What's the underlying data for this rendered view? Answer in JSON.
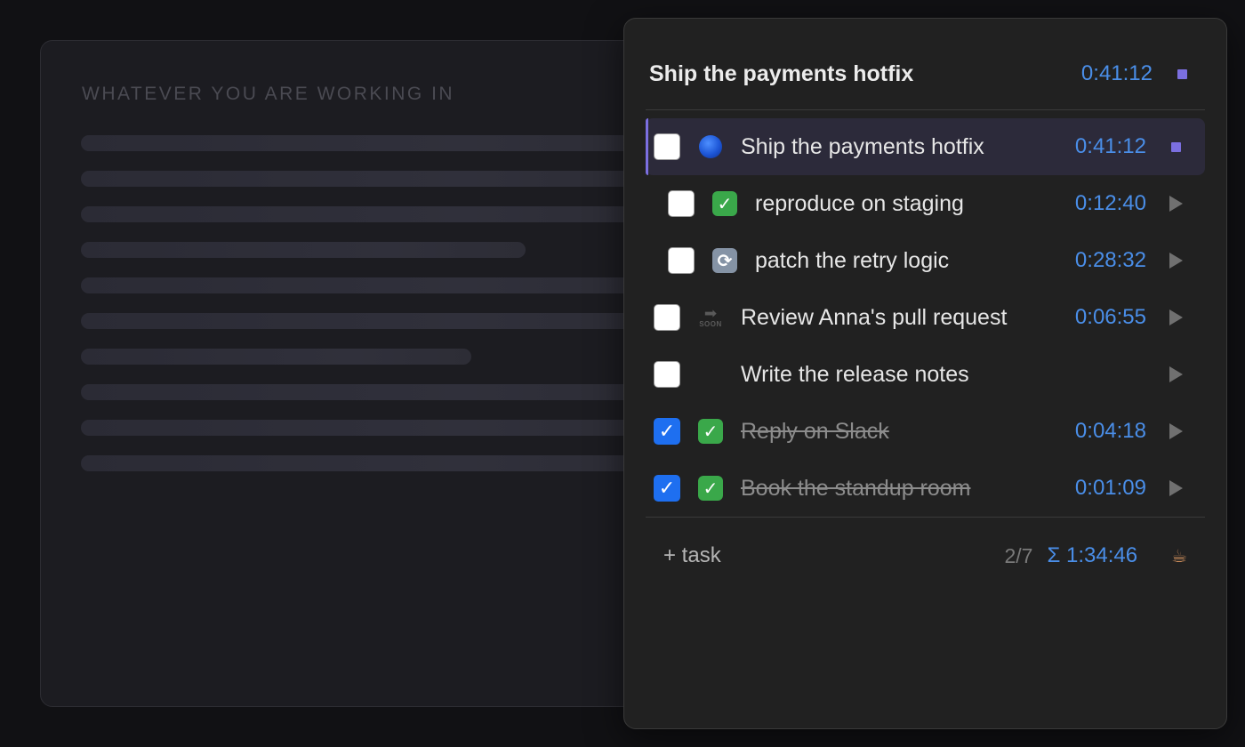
{
  "background_window": {
    "title": "WHATEVER YOU ARE WORKING IN"
  },
  "panel": {
    "header": {
      "title": "Ship the payments hotfix",
      "time": "0:41:12",
      "control_icon": "stop-icon"
    },
    "tasks": [
      {
        "label": "Ship the payments hotfix",
        "time": "0:41:12",
        "status_icon": "blue-circle-icon",
        "checked": false,
        "done": false,
        "active": true,
        "subtask": false,
        "control_icon": "stop-icon"
      },
      {
        "label": "reproduce on staging",
        "time": "0:12:40",
        "status_icon": "green-check-icon",
        "checked": false,
        "done": false,
        "active": false,
        "subtask": true,
        "control_icon": "play-icon"
      },
      {
        "label": "patch the retry logic",
        "time": "0:28:32",
        "status_icon": "cycle-icon",
        "checked": false,
        "done": false,
        "active": false,
        "subtask": true,
        "control_icon": "play-icon"
      },
      {
        "label": "Review Anna's pull request",
        "time": "0:06:55",
        "status_icon": "soon-arrow-icon",
        "checked": false,
        "done": false,
        "active": false,
        "subtask": false,
        "control_icon": "play-icon"
      },
      {
        "label": "Write the release notes",
        "time": "",
        "status_icon": "none",
        "checked": false,
        "done": false,
        "active": false,
        "subtask": false,
        "control_icon": "play-icon"
      },
      {
        "label": "Reply on Slack",
        "time": "0:04:18",
        "status_icon": "green-check-icon",
        "checked": true,
        "done": true,
        "active": false,
        "subtask": false,
        "control_icon": "play-icon"
      },
      {
        "label": "Book the standup room",
        "time": "0:01:09",
        "status_icon": "green-check-icon",
        "checked": true,
        "done": true,
        "active": false,
        "subtask": false,
        "control_icon": "play-icon"
      }
    ],
    "icon_text": {
      "soon_label": "SOON"
    },
    "footer": {
      "add_task_label": "+ task",
      "count": "2/7",
      "total": "Σ 1:34:46",
      "break_icon": "coffee-icon"
    }
  },
  "colors": {
    "accent_time": "#4a8ee8",
    "active_marker": "#7b6fe0",
    "checkbox_checked": "#1e6ff0",
    "panel_bg": "#212121"
  }
}
